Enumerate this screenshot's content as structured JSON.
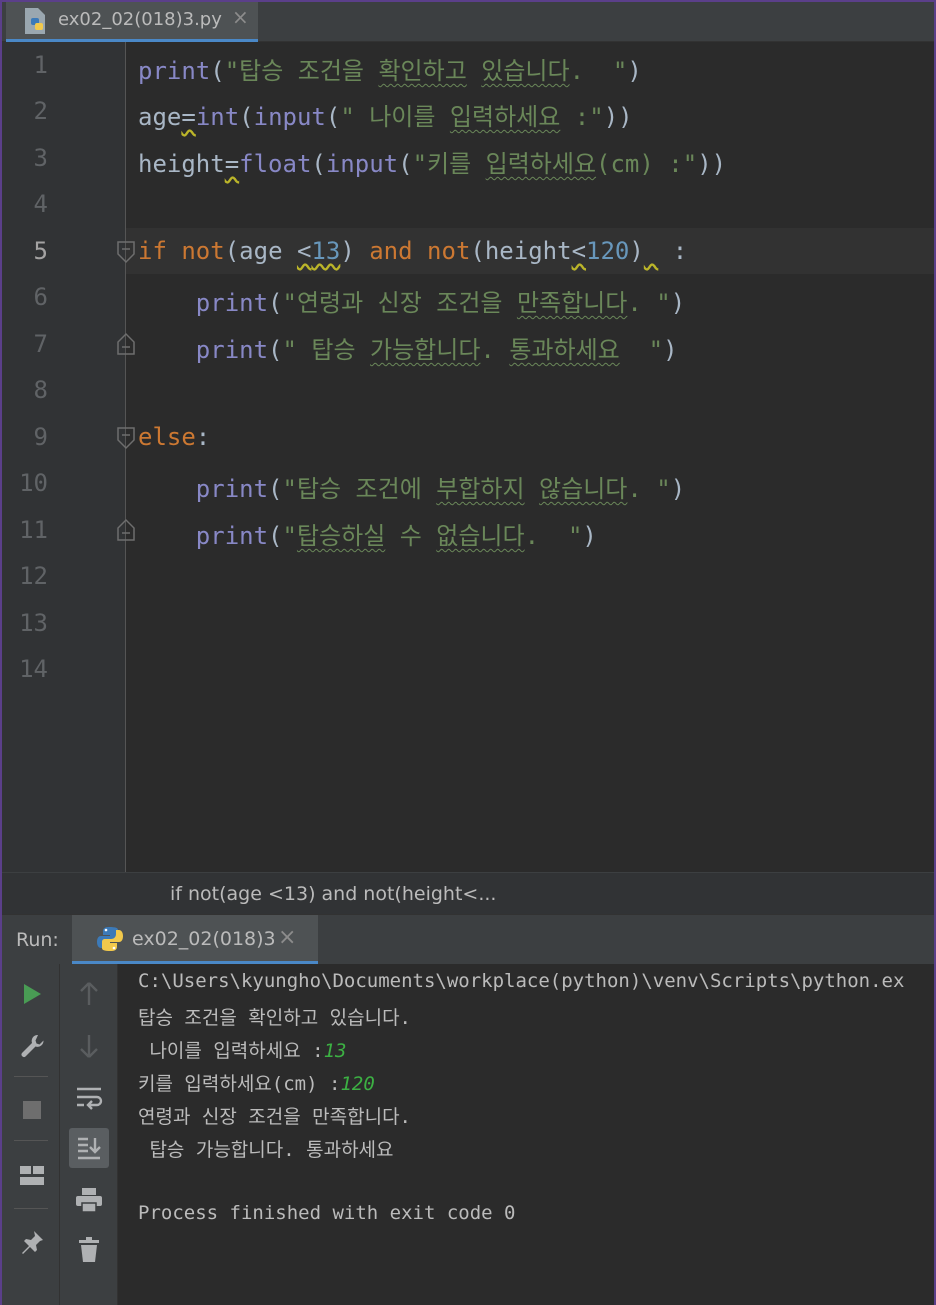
{
  "tab": {
    "filename": "ex02_02(018)3.py",
    "close": "×"
  },
  "editor": {
    "line_numbers": [
      "1",
      "2",
      "3",
      "4",
      "5",
      "6",
      "7",
      "8",
      "9",
      "10",
      "11",
      "12",
      "13",
      "14"
    ]
  },
  "breadcrumb": {
    "text": "if not(age <13) and not(height<..."
  },
  "run": {
    "title": "Run:",
    "tab_label": "ex02_02(018)3",
    "close": "×"
  },
  "console": {
    "command": "C:\\Users\\kyungho\\Documents\\workplace(python)\\venv\\Scripts\\python.ex",
    "line1": "탑승 조건을 확인하고 있습니다.",
    "prompt_age": " 나이를 입력하세요 :",
    "input_age": "13",
    "prompt_height": "키를 입력하세요(cm) :",
    "input_height": "120",
    "line4": "연령과 신장 조건을 만족합니다.",
    "line5": " 탑승 가능합니다. 통과하세요",
    "exit": "Process finished with exit code 0"
  },
  "colors": {
    "keyword": "#cc7832",
    "builtin": "#8888c6",
    "string": "#6a8759",
    "number": "#6897bb",
    "input_text": "#3cb043",
    "accent": "#4a88c7"
  },
  "icons": [
    "python-file-icon",
    "python-icon",
    "run-icon",
    "wrench-icon",
    "stop-icon",
    "layout-icon",
    "pin-icon",
    "up-arrow-icon",
    "down-arrow-icon",
    "soft-wrap-icon",
    "scroll-to-end-icon",
    "print-icon",
    "trash-icon",
    "fold-icon"
  ]
}
